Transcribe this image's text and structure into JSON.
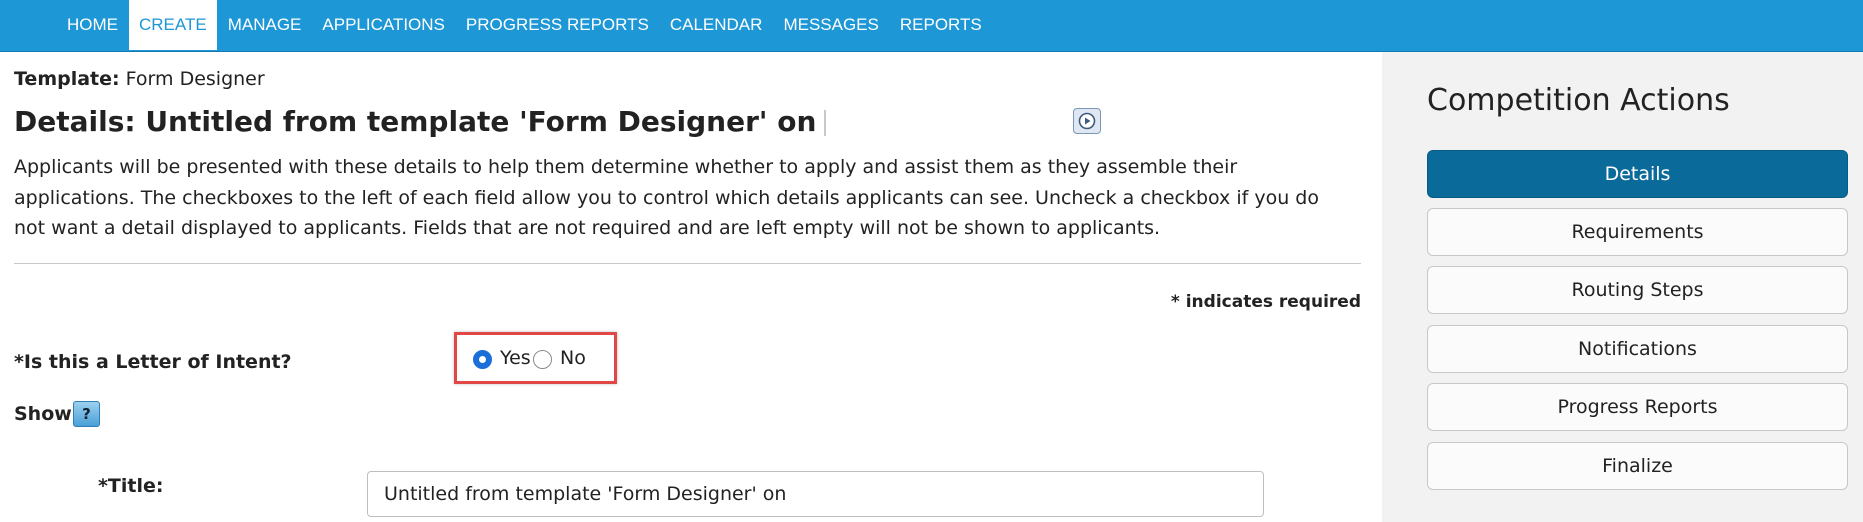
{
  "nav": {
    "items": [
      "HOME",
      "CREATE",
      "MANAGE",
      "APPLICATIONS",
      "PROGRESS REPORTS",
      "CALENDAR",
      "MESSAGES",
      "REPORTS"
    ],
    "active": "CREATE"
  },
  "template": {
    "label": "Template:",
    "value": "Form Designer"
  },
  "details_title": "Details: Untitled from template 'Form Designer' on",
  "intro_text": "Applicants will be presented with these details to help them determine whether to apply and assist them as they assemble their applications. The checkboxes to the left of each field allow you to control which details applicants can see. Uncheck a checkbox if you do not want a detail displayed to applicants. Fields that are not required and are left empty will not be shown to applicants.",
  "required_note": "* indicates required",
  "loi": {
    "label": "*Is this a Letter of Intent?",
    "options": [
      "Yes",
      "No"
    ],
    "selected": "Yes"
  },
  "show_label": "Show",
  "help_icon_text": "?",
  "title_field": {
    "label": "*Title:",
    "value": "Untitled from template 'Form Designer' on"
  },
  "sidebar": {
    "title": "Competition Actions",
    "actions": [
      "Details",
      "Requirements",
      "Routing Steps",
      "Notifications",
      "Progress Reports",
      "Finalize"
    ],
    "active": "Details"
  },
  "icons": {
    "video": "play-circle-icon",
    "help": "help-icon"
  },
  "colors": {
    "nav_bg": "#1d97d5",
    "primary_btn": "#0a6a9a",
    "highlight": "#e04848",
    "radio": "#1a6fd8"
  }
}
